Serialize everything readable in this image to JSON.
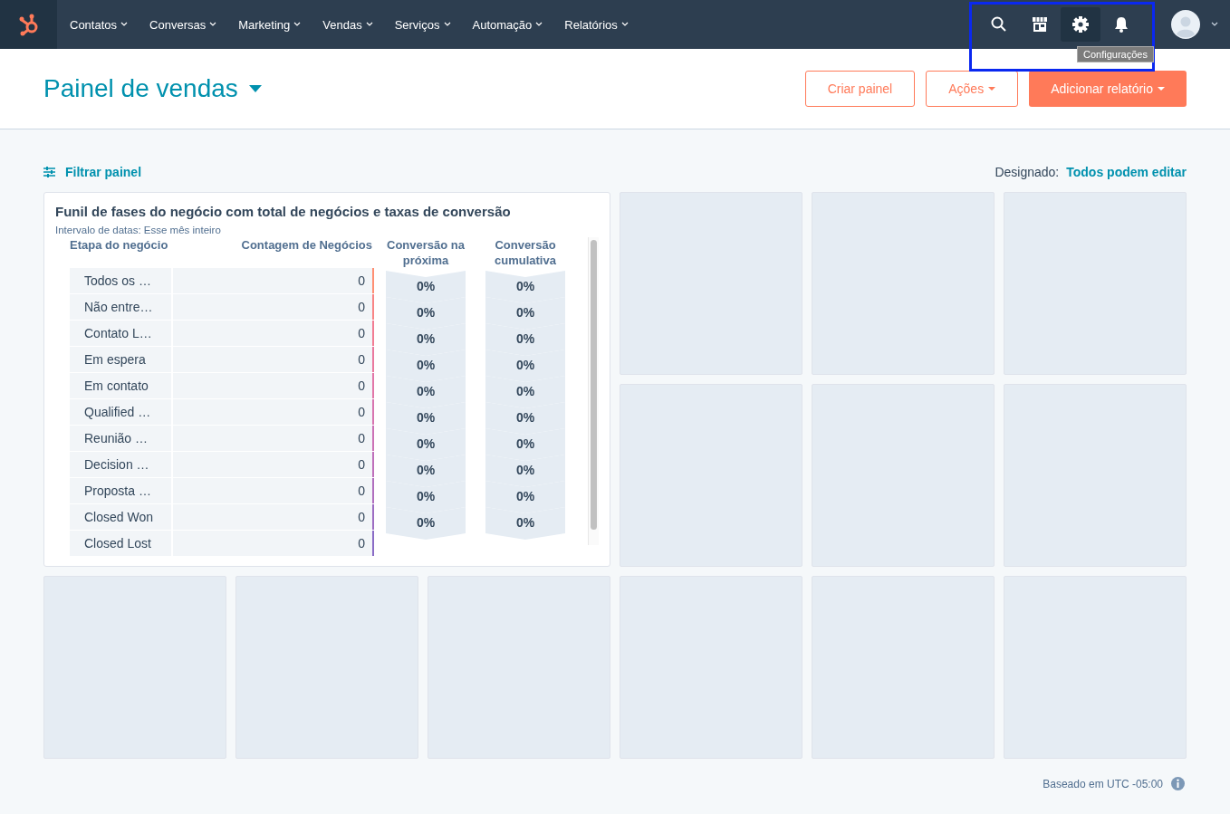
{
  "nav": {
    "menus": [
      {
        "label": "Contatos"
      },
      {
        "label": "Conversas"
      },
      {
        "label": "Marketing"
      },
      {
        "label": "Vendas"
      },
      {
        "label": "Serviços"
      },
      {
        "label": "Automação"
      },
      {
        "label": "Relatórios"
      }
    ],
    "icons": [
      {
        "kind": "search",
        "active": false
      },
      {
        "kind": "marketplace",
        "active": false
      },
      {
        "kind": "settings",
        "active": true,
        "tooltip": "Configurações"
      },
      {
        "kind": "notifications",
        "active": false
      }
    ],
    "icons_highlighted": true
  },
  "header": {
    "title": "Painel de vendas",
    "buttons": [
      {
        "label": "Criar painel",
        "kind": "outline",
        "dropdown": false
      },
      {
        "label": "Ações",
        "kind": "outline",
        "dropdown": true
      },
      {
        "label": "Adicionar relatório",
        "kind": "primary",
        "dropdown": true
      }
    ]
  },
  "filter_bar": {
    "filter_link": "Filtrar painel",
    "assigned_label": "Designado:",
    "assigned_link": "Todos podem editar"
  },
  "report": {
    "title": "Funil de fases do negócio com total de negócios e taxas de conversão",
    "subtitle": "Intervalo de datas: Esse mês inteiro",
    "columns": [
      "Etapa do negócio",
      "Contagem de Negócios",
      "Conversão na próxima",
      "Conversão cumulativa"
    ],
    "stages": [
      {
        "name": "Todos os …",
        "count": "0",
        "color": "#ff8f73"
      },
      {
        "name": "Não entre…",
        "count": "0",
        "color": "#f98585"
      },
      {
        "name": "Contato L…",
        "count": "0",
        "color": "#f27d93"
      },
      {
        "name": "Em espera",
        "count": "0",
        "color": "#ea799e"
      },
      {
        "name": "Em contato",
        "count": "0",
        "color": "#e277a8"
      },
      {
        "name": "Qualified …",
        "count": "0",
        "color": "#d875b0"
      },
      {
        "name": "Reunião …",
        "count": "0",
        "color": "#cc72b6"
      },
      {
        "name": "Decision …",
        "count": "0",
        "color": "#bf70bb"
      },
      {
        "name": "Proposta …",
        "count": "0",
        "color": "#b06fbf"
      },
      {
        "name": "Closed Won",
        "count": "0",
        "color": "#9d6dc3"
      },
      {
        "name": "Closed Lost",
        "count": "0",
        "color": "#8a6cc6"
      }
    ],
    "next_conversion": [
      "0%",
      "0%",
      "0%",
      "0%",
      "0%",
      "0%",
      "0%",
      "0%",
      "0%",
      "0%"
    ],
    "cumulative_conversion": [
      "0%",
      "0%",
      "0%",
      "0%",
      "0%",
      "0%",
      "0%",
      "0%",
      "0%",
      "0%"
    ]
  },
  "loading_tiles": [
    {
      "kind": "loading"
    },
    {
      "kind": "loading"
    },
    {
      "kind": "loading"
    },
    {
      "kind": "loading"
    },
    {
      "kind": "loading"
    },
    {
      "kind": "loading"
    },
    {
      "kind": "loading"
    },
    {
      "kind": "loading"
    },
    {
      "kind": "loading"
    },
    {
      "kind": "loading"
    },
    {
      "kind": "loading"
    },
    {
      "kind": "loading"
    }
  ],
  "footer": {
    "timezone": "Baseado em UTC -05:00"
  }
}
